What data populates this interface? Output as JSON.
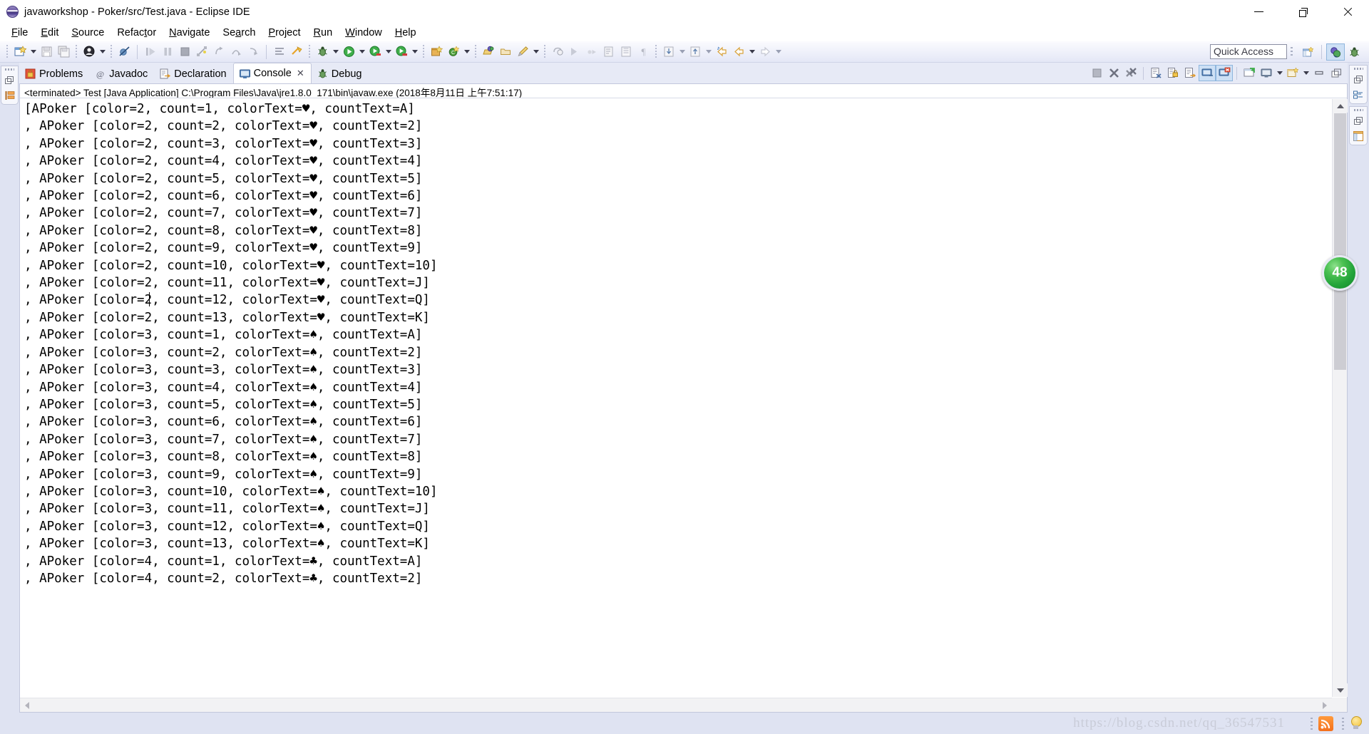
{
  "window": {
    "title": "javaworkshop - Poker/src/Test.java - Eclipse IDE",
    "app_icon": "eclipse-icon",
    "minimize_label": "Minimize",
    "maximize_label": "Restore",
    "close_label": "Close"
  },
  "menubar": {
    "items": [
      {
        "label": "File",
        "mnemonic": "F"
      },
      {
        "label": "Edit",
        "mnemonic": "E"
      },
      {
        "label": "Source",
        "mnemonic": "S"
      },
      {
        "label": "Refactor",
        "mnemonic": "t"
      },
      {
        "label": "Navigate",
        "mnemonic": "N"
      },
      {
        "label": "Search",
        "mnemonic": "a"
      },
      {
        "label": "Project",
        "mnemonic": "P"
      },
      {
        "label": "Run",
        "mnemonic": "R"
      },
      {
        "label": "Window",
        "mnemonic": "W"
      },
      {
        "label": "Help",
        "mnemonic": "H"
      }
    ]
  },
  "toolbar": {
    "buttons": [
      "new-wizard-icon",
      "save-icon",
      "save-all-icon",
      "debug-perspective-icon",
      "skip-breakpoints-icon",
      "resume-icon",
      "suspend-icon",
      "terminate-icon",
      "disconnect-icon",
      "step-return-icon",
      "step-over-icon",
      "step-into-icon",
      "toggle-stepfilters-icon",
      "build-icon",
      "debug-icon",
      "run-icon",
      "run-external-tools-icon",
      "new-java-project-icon",
      "new-class-icon",
      "open-type-icon",
      "open-task-icon",
      "search-icon",
      "annotation-icon",
      "last-edit-icon",
      "marker-icon",
      "bookmark-icon",
      "outline-icon",
      "pilcrow-icon",
      "next-annotation-icon",
      "previous-annotation-icon",
      "back-icon",
      "forward-icon"
    ]
  },
  "quick_access": {
    "placeholder": "Quick Access",
    "value": "Quick Access"
  },
  "perspective_bar": {
    "buttons": [
      "open-perspective-icon",
      "java-perspective-icon",
      "debug-perspective-icon"
    ],
    "active": "java-perspective-icon"
  },
  "view_tabs": {
    "tabs": [
      {
        "label": "Problems",
        "icon": "problems-icon",
        "active": false,
        "closeable": false
      },
      {
        "label": "Javadoc",
        "icon": "javadoc-icon",
        "active": false,
        "closeable": false
      },
      {
        "label": "Declaration",
        "icon": "declaration-icon",
        "active": false,
        "closeable": false
      },
      {
        "label": "Console",
        "icon": "console-icon",
        "active": true,
        "closeable": true
      },
      {
        "label": "Debug",
        "icon": "debug-icon",
        "active": false,
        "closeable": false
      }
    ],
    "tools": [
      "terminate-icon",
      "remove-launch-icon",
      "remove-all-launches-icon",
      "clear-console-icon",
      "scroll-lock-icon",
      "word-wrap-icon",
      "show-console-on-stdout-icon",
      "show-console-on-stderr-icon",
      "pin-console-icon",
      "display-selected-console-icon",
      "open-console-icon",
      "minimize-icon",
      "maximize-icon"
    ]
  },
  "console": {
    "status_line": "<terminated> Test [Java Application] C:\\Program Files\\Java\\jre1.8.0_171\\bin\\javaw.exe (2018年8月11日 上午7:51:17)",
    "lines": [
      "[APoker [color=2, count=1, colorText=♥, countText=A]",
      ", APoker [color=2, count=2, colorText=♥, countText=2]",
      ", APoker [color=2, count=3, colorText=♥, countText=3]",
      ", APoker [color=2, count=4, colorText=♥, countText=4]",
      ", APoker [color=2, count=5, colorText=♥, countText=5]",
      ", APoker [color=2, count=6, colorText=♥, countText=6]",
      ", APoker [color=2, count=7, colorText=♥, countText=7]",
      ", APoker [color=2, count=8, colorText=♥, countText=8]",
      ", APoker [color=2, count=9, colorText=♥, countText=9]",
      ", APoker [color=2, count=10, colorText=♥, countText=10]",
      ", APoker [color=2, count=11, colorText=♥, countText=J]",
      ", APoker [color=2, count=12, colorText=♥, countText=Q]",
      ", APoker [color=2, count=13, colorText=♥, countText=K]",
      ", APoker [color=3, count=1, colorText=♠, countText=A]",
      ", APoker [color=3, count=2, colorText=♠, countText=2]",
      ", APoker [color=3, count=3, colorText=♠, countText=3]",
      ", APoker [color=3, count=4, colorText=♠, countText=4]",
      ", APoker [color=3, count=5, colorText=♠, countText=5]",
      ", APoker [color=3, count=6, colorText=♠, countText=6]",
      ", APoker [color=3, count=7, colorText=♠, countText=7]",
      ", APoker [color=3, count=8, colorText=♠, countText=8]",
      ", APoker [color=3, count=9, colorText=♠, countText=9]",
      ", APoker [color=3, count=10, colorText=♠, countText=10]",
      ", APoker [color=3, count=11, colorText=♠, countText=J]",
      ", APoker [color=3, count=12, colorText=♠, countText=Q]",
      ", APoker [color=3, count=13, colorText=♠, countText=K]",
      ", APoker [color=4, count=1, colorText=♣, countText=A]",
      ", APoker [color=4, count=2, colorText=♣, countText=2]"
    ]
  },
  "notification_badge": {
    "count": "48"
  },
  "status_bar": {
    "watermark": "https://blog.csdn.net/qq_36547531"
  },
  "colors": {
    "accent": "#3a6ea5",
    "toolbar_bg": "#eef0fa",
    "dock_bg": "#dfe3f2",
    "badge_green": "#23a43a",
    "console_bg": "#ffffff"
  }
}
